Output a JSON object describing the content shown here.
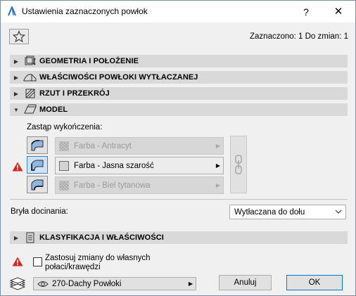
{
  "window": {
    "title": "Ustawienia zaznaczonych powłok",
    "help_label": "?",
    "close_label": "✕"
  },
  "selection_info": "Zaznaczono: 1 Do zmian: 1",
  "sections": [
    {
      "label": "GEOMETRIA I POŁOŻENIE",
      "expanded": false,
      "icon": "geometry-icon"
    },
    {
      "label": "WŁAŚCIWOŚCI POWŁOKI WYTŁACZANEJ",
      "expanded": false,
      "icon": "extruded-shell-icon"
    },
    {
      "label": "RZUT I PRZEKRÓJ",
      "expanded": false,
      "icon": "floorplan-section-icon"
    },
    {
      "label": "MODEL",
      "expanded": true,
      "icon": "model-icon"
    },
    {
      "label": "KLASYFIKACJA I WŁAŚCIWOŚCI",
      "expanded": false,
      "icon": "classification-icon"
    }
  ],
  "model": {
    "override_label": "Zastąp wykończenia:",
    "finishes": [
      {
        "name": "Farba - Antracyt",
        "enabled": false
      },
      {
        "name": "Farba - Jasna szarość",
        "enabled": true
      },
      {
        "name": "Farba - Biel tytanowa",
        "enabled": false
      }
    ],
    "cut_body_label": "Bryła docinania:",
    "cut_body_value": "Wytłaczana do dołu"
  },
  "footer": {
    "apply_label": "Zastosuj zmiany do własnych połaci/krawędzi",
    "apply_checked": false,
    "layer_value": "270-Dachy Powłoki",
    "cancel_label": "Anuluj",
    "ok_label": "OK"
  },
  "colors": {
    "section_bg": "#d9d9d9",
    "active_button": "#cfe3f7",
    "warning": "#d9261c",
    "ok_border": "#0078d7"
  }
}
